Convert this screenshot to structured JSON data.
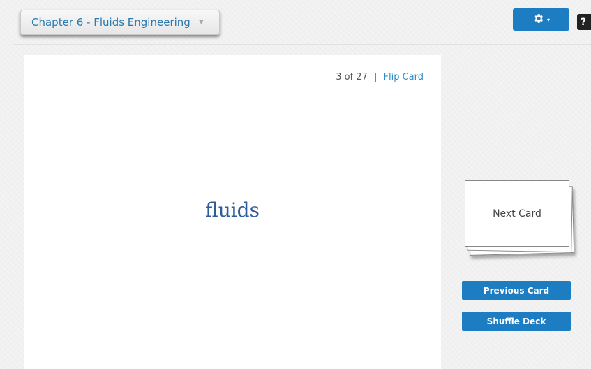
{
  "header": {
    "deck_title": "Chapter 6 - Fluids Engineering",
    "dropdown_caret": "▼",
    "settings_icon": "gear-icon",
    "settings_caret": "▾",
    "help_label": "?"
  },
  "card": {
    "current": "3",
    "of_label": "of",
    "total": "27",
    "separator": "|",
    "flip_label": "Flip Card",
    "term": "fluids"
  },
  "controls": {
    "next_card_label": "Next Card",
    "previous_card_label": "Previous Card",
    "shuffle_label": "Shuffle Deck"
  },
  "colors": {
    "accent": "#1c7dc2",
    "link": "#2a8fd0",
    "term_text": "#2d5d9a"
  }
}
